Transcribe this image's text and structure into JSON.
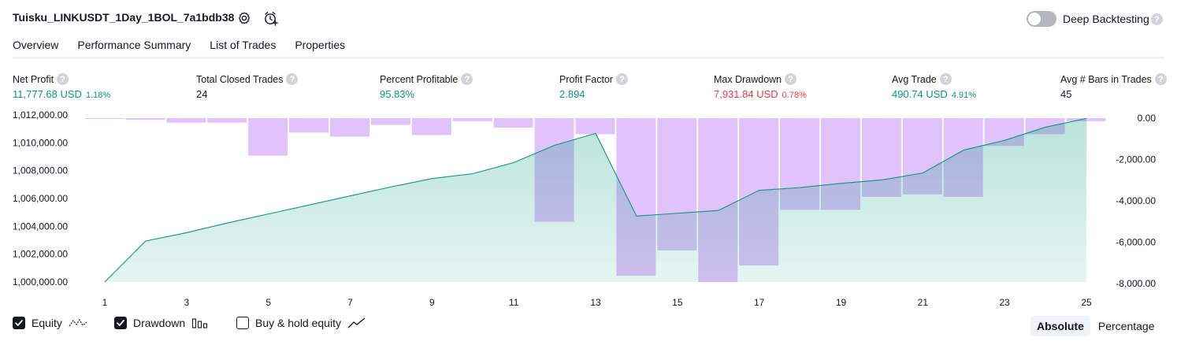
{
  "header": {
    "strategy_title": "Tuisku_LINKUSDT_1Day_1BOL_7a1bdb38",
    "settings_icon": "gear-icon",
    "alert_icon": "alarm-clock-plus-icon",
    "deep_backtesting_label": "Deep Backtesting",
    "deep_backtesting_enabled": false,
    "help_glyph": "?"
  },
  "tabs": [
    {
      "label": "Overview",
      "active": true
    },
    {
      "label": "Performance Summary",
      "active": false
    },
    {
      "label": "List of Trades",
      "active": false
    },
    {
      "label": "Properties",
      "active": false
    }
  ],
  "metrics": [
    {
      "label": "Net Profit",
      "value": "11,777.68 USD",
      "pct": "1.18%",
      "color": "#089981"
    },
    {
      "label": "Total Closed Trades",
      "value": "24",
      "pct": "",
      "color": "#131722"
    },
    {
      "label": "Percent Profitable",
      "value": "95.83%",
      "pct": "",
      "color": "#089981"
    },
    {
      "label": "Profit Factor",
      "value": "2.894",
      "pct": "",
      "color": "#089981"
    },
    {
      "label": "Max Drawdown",
      "value": "7,931.84 USD",
      "pct": "0.78%",
      "color": "#f23645"
    },
    {
      "label": "Avg Trade",
      "value": "490.74 USD",
      "pct": "4.91%",
      "color": "#089981"
    },
    {
      "label": "Avg # Bars in Trades",
      "value": "45",
      "pct": "",
      "color": "#131722"
    }
  ],
  "chart_data": {
    "type": "area",
    "x_ticks": [
      "1",
      "3",
      "5",
      "7",
      "9",
      "11",
      "13",
      "15",
      "17",
      "19",
      "21",
      "23",
      "25"
    ],
    "y_left_ticks": [
      "1,012,000.00",
      "1,010,000.00",
      "1,008,000.00",
      "1,006,000.00",
      "1,004,000.00",
      "1,002,000.00",
      "1,000,000.00"
    ],
    "y_right_ticks": [
      "0.00",
      "-2,000.00",
      "-4,000.00",
      "-6,000.00",
      "-8,000.00"
    ],
    "y_left_range": [
      1000000,
      1011800
    ],
    "y_right_range": [
      -7950,
      0
    ],
    "x_range": [
      1,
      25
    ],
    "series": [
      {
        "name": "Equity",
        "axis": "left",
        "color": "#089981",
        "x": [
          1,
          2,
          3,
          4,
          5,
          6,
          7,
          8,
          9,
          10,
          11,
          12,
          13,
          14,
          15,
          16,
          17,
          18,
          19,
          20,
          21,
          22,
          23,
          24,
          25
        ],
        "values": [
          1000000,
          1002950,
          1003550,
          1004250,
          1004900,
          1005550,
          1006200,
          1006850,
          1007450,
          1007800,
          1008600,
          1009850,
          1010700,
          1004750,
          1004950,
          1005150,
          1006600,
          1006800,
          1007100,
          1007350,
          1007850,
          1009500,
          1010200,
          1011150,
          1011780
        ]
      },
      {
        "name": "Drawdown",
        "axis": "right",
        "color": "#b39ddb",
        "x": [
          1,
          2,
          3,
          4,
          5,
          6,
          7,
          8,
          9,
          10,
          11,
          12,
          13,
          14,
          15,
          16,
          17,
          18,
          19,
          20,
          21,
          22,
          23,
          24,
          25
        ],
        "values": [
          -40,
          -80,
          -220,
          -220,
          -1820,
          -700,
          -900,
          -330,
          -820,
          -150,
          -460,
          -5030,
          -780,
          -7650,
          -6420,
          -7950,
          -7150,
          -4450,
          -4450,
          -3820,
          -3700,
          -3820,
          -1350,
          -780,
          -150
        ]
      }
    ],
    "grid": false
  },
  "legend": {
    "items": [
      {
        "label": "Equity",
        "checked": true,
        "icon": "equity-line-icon"
      },
      {
        "label": "Drawdown",
        "checked": true,
        "icon": "drawdown-bars-icon"
      },
      {
        "label": "Buy & hold equity",
        "checked": false,
        "icon": "buy-hold-line-icon"
      }
    ]
  },
  "view_mode": {
    "options": [
      "Absolute",
      "Percentage"
    ],
    "selected": "Absolute"
  }
}
